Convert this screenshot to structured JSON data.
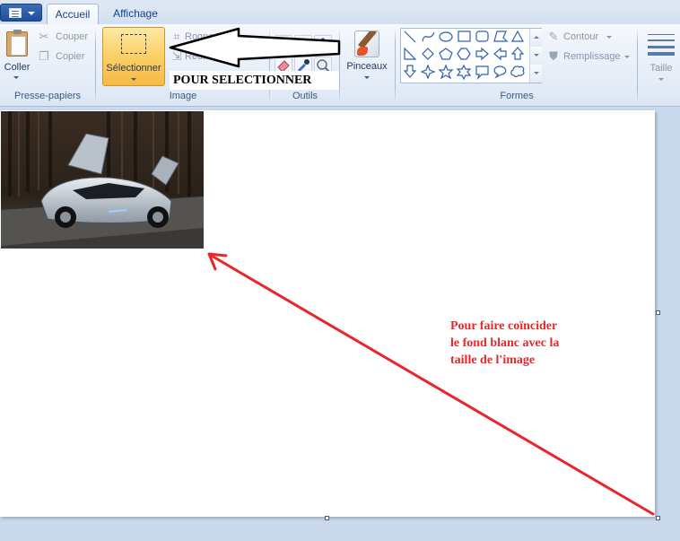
{
  "tabs": {
    "home": "Accueil",
    "view": "Affichage"
  },
  "clipboard": {
    "paste": "Coller",
    "cut": "Couper",
    "copy": "Copier",
    "group": "Presse-papiers"
  },
  "image": {
    "select": "Sélectionner",
    "crop": "Rogner",
    "resize": "Redimensionner",
    "group": "Image"
  },
  "tools": {
    "group": "Outils",
    "text_icon": "A"
  },
  "brushes": {
    "label": "Pinceaux"
  },
  "shapes": {
    "outline": "Contour",
    "fill": "Remplissage",
    "group": "Formes"
  },
  "size": {
    "label": "Taille"
  },
  "annotations": {
    "select_callout": "POUR SELECTIONNER",
    "note": "Pour faire coïncider le fond blanc avec la taille de l'image",
    "arrow_color": "#e8262b"
  },
  "icons": [
    "app-menu-icon",
    "clipboard-icon",
    "scissors-icon",
    "copy-icon",
    "selection-icon",
    "crop-icon",
    "resize-icon",
    "rotate-icon",
    "pencil-icon",
    "fill-icon",
    "text-icon",
    "eraser-icon",
    "color-picker-icon",
    "magnifier-icon",
    "brush-icon",
    "outline-icon",
    "fill-bucket-icon",
    "size-icon"
  ]
}
